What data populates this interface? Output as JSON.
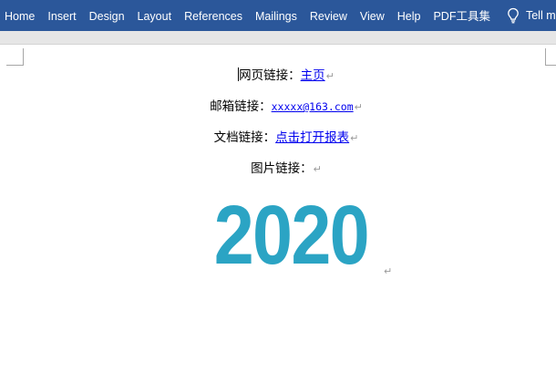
{
  "ribbon": {
    "tabs": [
      {
        "label": "Home"
      },
      {
        "label": "Insert"
      },
      {
        "label": "Design"
      },
      {
        "label": "Layout"
      },
      {
        "label": "References"
      },
      {
        "label": "Mailings"
      },
      {
        "label": "Review"
      },
      {
        "label": "View"
      },
      {
        "label": "Help"
      },
      {
        "label": "PDF工具集"
      }
    ],
    "tell_me_label": "Tell me",
    "tell_me_icon": "lightbulb-icon",
    "bg_color": "#2b579a"
  },
  "document": {
    "lines": [
      {
        "label": "网页链接：",
        "link": "主页"
      },
      {
        "label": "邮箱链接：",
        "link": "xxxxx@163.com"
      },
      {
        "label": "文档链接：",
        "link": "点击打开报表"
      },
      {
        "label": "图片链接："
      }
    ],
    "paragraph_mark": "↵",
    "image_text": "2020",
    "image_color": "#2ba4c4",
    "link_color": "#0000ee"
  }
}
